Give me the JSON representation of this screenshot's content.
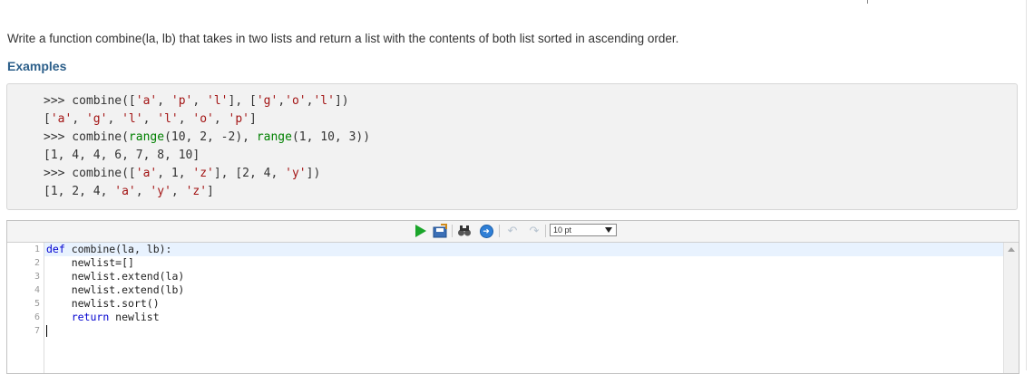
{
  "question": {
    "text": "Write a function combine(la, lb) that takes in two lists and return a list with the contents of both list sorted in ascending order.",
    "examples_heading": "Examples"
  },
  "examples": [
    {
      "call_parts": [
        ">>> combine([",
        "'a'",
        ", ",
        "'p'",
        ", ",
        "'l'",
        "], [",
        "'g'",
        ",",
        "'o'",
        ",",
        "'l'",
        "])"
      ],
      "result_parts": [
        "[",
        "'a'",
        ", ",
        "'g'",
        ", ",
        "'l'",
        ", ",
        "'l'",
        ", ",
        "'o'",
        ", ",
        "'p'",
        "]"
      ]
    },
    {
      "call_parts": [
        ">>> combine(",
        "range",
        "(10, 2, -2), ",
        "range",
        "(1, 10, 3))"
      ],
      "result_parts": [
        "[1, 4, 4, 6, 7, 8, 10]"
      ]
    },
    {
      "call_parts": [
        ">>> combine([",
        "'a'",
        ", 1, ",
        "'z'",
        "], [2, 4, ",
        "'y'",
        "])"
      ],
      "result_parts": [
        "[1, 2, 4, ",
        "'a'",
        ", ",
        "'y'",
        ", ",
        "'z'",
        "]"
      ]
    }
  ],
  "toolbar": {
    "font_size": "10 pt",
    "icons": [
      "run-icon",
      "save-icon",
      "find-icon",
      "goto-icon",
      "undo-icon",
      "redo-icon"
    ]
  },
  "editor": {
    "line_numbers": [
      "1",
      "2",
      "3",
      "4",
      "5",
      "6",
      "7"
    ],
    "lines": [
      {
        "kw": "def",
        "rest": " combine(la, lb):"
      },
      {
        "indent": "    ",
        "rest": "newlist=[]"
      },
      {
        "indent": "    ",
        "rest": "newlist.extend(la)"
      },
      {
        "indent": "    ",
        "rest": "newlist.extend(lb)"
      },
      {
        "indent": "    ",
        "rest": "newlist.sort()"
      },
      {
        "indent": "    ",
        "kw": "return",
        "rest": " newlist"
      },
      {
        "rest": ""
      }
    ]
  },
  "colors": {
    "accent": "#2c5f8a",
    "string": "#a31515",
    "builtin": "#008000",
    "keyword": "#0000d0",
    "run": "#1aa52a"
  }
}
